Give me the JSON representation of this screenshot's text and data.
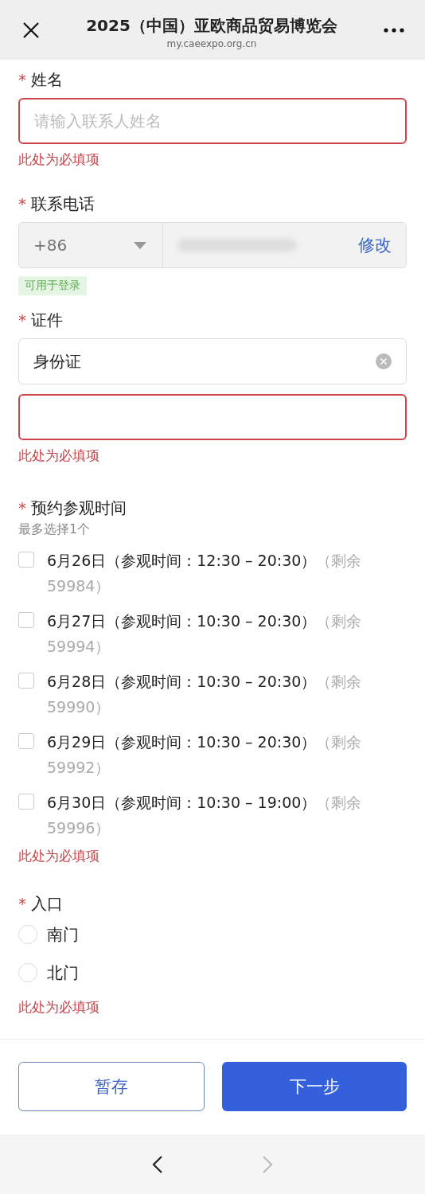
{
  "header": {
    "title": "2025（中国）亚欧商品贸易博览会",
    "url": "my.caeexpo.org.cn"
  },
  "name_field": {
    "marker": "*",
    "label": "姓名",
    "placeholder": "请输入联系人姓名",
    "error": "此处为必填项"
  },
  "phone_field": {
    "marker": "*",
    "label": "联系电话",
    "country_code": "+86",
    "action": "修改",
    "tag": "可用于登录"
  },
  "id_field": {
    "marker": "*",
    "label": "证件",
    "id_type": "身份证",
    "error": "此处为必填项"
  },
  "visit_time": {
    "marker": "*",
    "label": "预约参观时间",
    "hint": "最多选择1个",
    "error": "此处为必填项",
    "options": [
      {
        "label": "6月26日（参观时间：12:30 – 20:30）",
        "remaining": "（剩余 59984）",
        "checked": false
      },
      {
        "label": "6月27日（参观时间：10:30 – 20:30）",
        "remaining": "（剩余 59994）",
        "checked": false
      },
      {
        "label": "6月28日（参观时间：10:30 – 20:30）",
        "remaining": "（剩余 59990）",
        "checked": false
      },
      {
        "label": "6月29日（参观时间：10:30 – 20:30）",
        "remaining": "（剩余 59992）",
        "checked": false
      },
      {
        "label": "6月30日（参观时间：10:30 – 19:00）",
        "remaining": "（剩余 59996）",
        "checked": false
      }
    ]
  },
  "entrance": {
    "marker": "*",
    "label": "入口",
    "error": "此处为必填项",
    "options": [
      {
        "label": "南门",
        "selected": false
      },
      {
        "label": "北门",
        "selected": false
      }
    ]
  },
  "buttons": [
    {
      "label": "暂存",
      "kind": "secondary"
    },
    {
      "label": "下一步",
      "kind": "primary"
    }
  ],
  "nav": {
    "back_disabled": false,
    "forward_disabled": true
  }
}
